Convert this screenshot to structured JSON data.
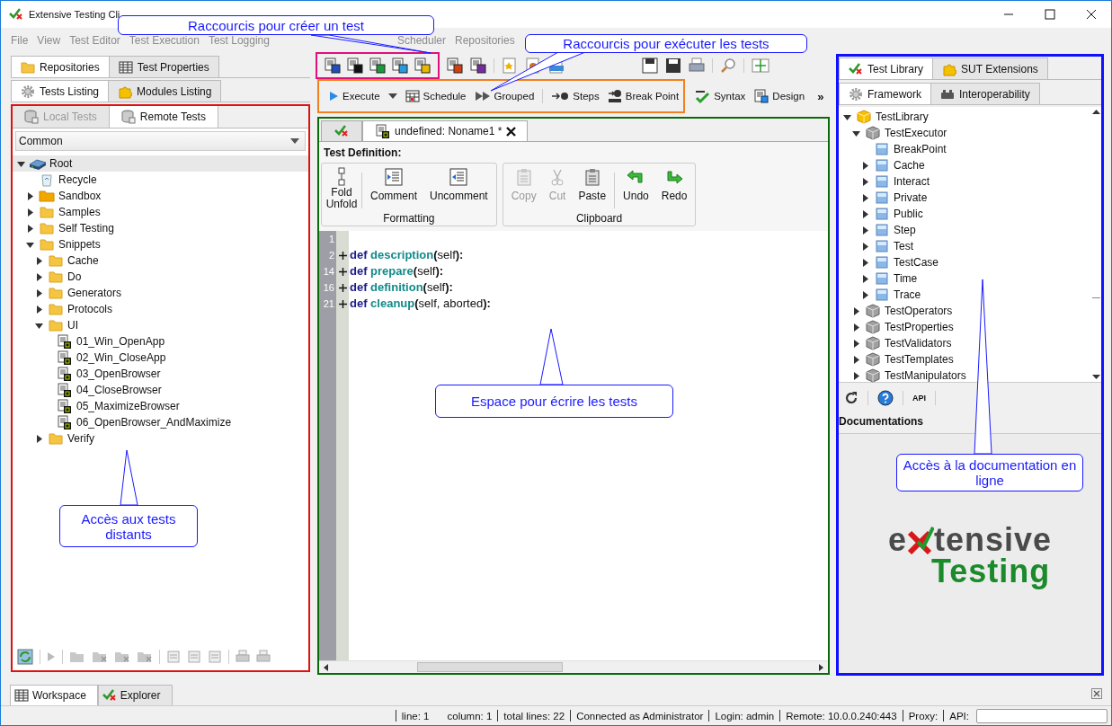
{
  "window": {
    "title": "Extensive Testing Cli"
  },
  "menu": [
    "File",
    "View",
    "Test Editor",
    "Test Execution",
    "Test Logging",
    "Scheduler",
    "Repositories"
  ],
  "toolbar": {
    "actions": [
      {
        "label": "Execute",
        "kind": "execute"
      },
      {
        "label": "Schedule",
        "kind": "schedule"
      },
      {
        "label": "Grouped",
        "kind": "grouped"
      },
      {
        "label": "Steps",
        "kind": "steps"
      },
      {
        "label": "Break Point",
        "kind": "breakpoint"
      },
      {
        "label": "Syntax",
        "kind": "syntax"
      },
      {
        "label": "Design",
        "kind": "design"
      }
    ],
    "overflow": "»"
  },
  "left_panel": {
    "tabs": [
      {
        "label": "Repositories",
        "kind": "folder",
        "selected": true
      },
      {
        "label": "Test Properties",
        "kind": "table",
        "selected": false
      }
    ],
    "subtabs": [
      {
        "label": "Tests Listing",
        "kind": "gear",
        "selected": true
      },
      {
        "label": "Modules Listing",
        "kind": "puzzle",
        "selected": false
      }
    ],
    "source_tabs": [
      {
        "label": "Local Tests",
        "selected": false
      },
      {
        "label": "Remote Tests",
        "selected": true
      }
    ],
    "project": "Common",
    "tree": [
      {
        "label": "Root",
        "kind": "drive",
        "expanded": true,
        "selected": true,
        "children": [
          {
            "label": "Recycle",
            "kind": "trash",
            "selected": false
          },
          {
            "label": "Sandbox",
            "kind": "sandbox",
            "expanded": false,
            "selected": false
          },
          {
            "label": "Samples",
            "kind": "folder",
            "expanded": false,
            "selected": false
          },
          {
            "label": "Self Testing",
            "kind": "folder",
            "expanded": false,
            "selected": false
          },
          {
            "label": "Snippets",
            "kind": "folder",
            "expanded": true,
            "selected": false,
            "children": [
              {
                "label": "Cache",
                "kind": "folder",
                "expanded": false,
                "selected": false
              },
              {
                "label": "Do",
                "kind": "folder",
                "expanded": false,
                "selected": false
              },
              {
                "label": "Generators",
                "kind": "folder",
                "expanded": false,
                "selected": false
              },
              {
                "label": "Protocols",
                "kind": "folder",
                "expanded": false,
                "selected": false
              },
              {
                "label": "UI",
                "kind": "folder",
                "expanded": true,
                "selected": false,
                "children": [
                  {
                    "label": "01_Win_OpenApp",
                    "kind": "test",
                    "selected": false
                  },
                  {
                    "label": "02_Win_CloseApp",
                    "kind": "test",
                    "selected": false
                  },
                  {
                    "label": "03_OpenBrowser",
                    "kind": "test",
                    "selected": false
                  },
                  {
                    "label": "04_CloseBrowser",
                    "kind": "test",
                    "selected": false
                  },
                  {
                    "label": "05_MaximizeBrowser",
                    "kind": "test",
                    "selected": false
                  },
                  {
                    "label": "06_OpenBrowser_AndMaximize",
                    "kind": "test",
                    "selected": false
                  }
                ]
              },
              {
                "label": "Verify",
                "kind": "folder",
                "expanded": false,
                "selected": false
              }
            ]
          }
        ]
      }
    ]
  },
  "editor": {
    "tabs": [
      {
        "kind": "icon",
        "selected": false
      },
      {
        "kind": "file",
        "label": "undefined: Noname1 *",
        "selected": true
      }
    ],
    "section": "Test Definition:",
    "groups": [
      {
        "title": "Formatting",
        "buttons": [
          {
            "label": "Fold Unfold",
            "kind": "fold",
            "disabled": false
          },
          {
            "label": "Comment",
            "kind": "comment",
            "disabled": false
          },
          {
            "label": "Uncomment",
            "kind": "uncomment",
            "disabled": false
          }
        ]
      },
      {
        "title": "Clipboard",
        "buttons": [
          {
            "label": "Copy",
            "kind": "copy",
            "disabled": true
          },
          {
            "label": "Cut",
            "kind": "cut",
            "disabled": true
          },
          {
            "label": "Paste",
            "kind": "paste",
            "disabled": false
          },
          {
            "label": "Undo",
            "kind": "undo",
            "disabled": false
          },
          {
            "label": "Redo",
            "kind": "redo",
            "disabled": false
          }
        ]
      }
    ],
    "lines": [
      {
        "number": "1",
        "folded": false
      },
      {
        "number": "2",
        "folded": true,
        "tokens": [
          {
            "text": "def",
            "kind": "keyword"
          },
          {
            "text": " description",
            "kind": "function"
          },
          {
            "text": "(",
            "kind": "punct"
          },
          {
            "text": "self",
            "kind": "plain"
          },
          {
            "text": "):",
            "kind": "punct"
          }
        ]
      },
      {
        "number": "14",
        "folded": true,
        "tokens": [
          {
            "text": "def",
            "kind": "keyword"
          },
          {
            "text": " prepare",
            "kind": "function"
          },
          {
            "text": "(",
            "kind": "punct"
          },
          {
            "text": "self",
            "kind": "plain"
          },
          {
            "text": "):",
            "kind": "punct"
          }
        ]
      },
      {
        "number": "16",
        "folded": true,
        "tokens": [
          {
            "text": "def",
            "kind": "keyword"
          },
          {
            "text": " definition",
            "kind": "function"
          },
          {
            "text": "(",
            "kind": "punct"
          },
          {
            "text": "self",
            "kind": "plain"
          },
          {
            "text": "):",
            "kind": "punct"
          }
        ]
      },
      {
        "number": "21",
        "folded": true,
        "tokens": [
          {
            "text": "def",
            "kind": "keyword"
          },
          {
            "text": " cleanup",
            "kind": "function"
          },
          {
            "text": "(",
            "kind": "punct"
          },
          {
            "text": "self, aborted",
            "kind": "plain"
          },
          {
            "text": "):",
            "kind": "punct"
          }
        ]
      }
    ]
  },
  "right_panel": {
    "tabs": [
      {
        "label": "Test Library",
        "kind": "checkx",
        "selected": true
      },
      {
        "label": "SUT Extensions",
        "kind": "puzzle",
        "selected": false
      }
    ],
    "subtabs": [
      {
        "label": "Framework",
        "kind": "gear",
        "selected": true
      },
      {
        "label": "Interoperability",
        "kind": "plug",
        "selected": false
      }
    ],
    "tree": [
      {
        "label": "TestLibrary",
        "kind": "package",
        "expanded": true,
        "selected": false,
        "children": [
          {
            "label": "TestExecutor",
            "kind": "module",
            "expanded": true,
            "selected": false,
            "children": [
              {
                "label": "BreakPoint",
                "kind": "class",
                "selected": false
              },
              {
                "label": "Cache",
                "kind": "class",
                "expanded": false,
                "selected": false
              },
              {
                "label": "Interact",
                "kind": "class",
                "expanded": false,
                "selected": false
              },
              {
                "label": "Private",
                "kind": "class",
                "expanded": false,
                "selected": false
              },
              {
                "label": "Public",
                "kind": "class",
                "expanded": false,
                "selected": false
              },
              {
                "label": "Step",
                "kind": "class",
                "expanded": false,
                "selected": false
              },
              {
                "label": "Test",
                "kind": "class",
                "expanded": false,
                "selected": false
              },
              {
                "label": "TestCase",
                "kind": "class",
                "expanded": false,
                "selected": false
              },
              {
                "label": "Time",
                "kind": "class",
                "expanded": false,
                "selected": false
              },
              {
                "label": "Trace",
                "kind": "class",
                "expanded": false,
                "selected": false
              }
            ]
          },
          {
            "label": "TestOperators",
            "kind": "module",
            "expanded": false,
            "selected": false
          },
          {
            "label": "TestProperties",
            "kind": "module",
            "expanded": false,
            "selected": false
          },
          {
            "label": "TestValidators",
            "kind": "module",
            "expanded": false,
            "selected": false
          },
          {
            "label": "TestTemplates",
            "kind": "module",
            "expanded": false,
            "selected": false
          },
          {
            "label": "TestManipulators",
            "kind": "module",
            "expanded": false,
            "selected": false
          }
        ]
      }
    ],
    "api_button": "API",
    "doc_title": "Documentations",
    "logo": {
      "start": "e",
      "end": "tensive",
      "second": "Testing"
    }
  },
  "bottom_tabs": [
    {
      "label": "Workspace",
      "kind": "table",
      "selected": true
    },
    {
      "label": "Explorer",
      "kind": "checkx",
      "selected": false
    }
  ],
  "status_bar": [
    [
      "line: 1",
      "column: 1"
    ],
    [
      "total lines: 22"
    ],
    [
      "Connected as Administrator"
    ],
    [
      "Login: admin"
    ],
    [
      "Remote: 10.0.0.240:443"
    ],
    [
      "Proxy:"
    ],
    [
      "API:"
    ]
  ],
  "callouts": [
    "Raccourcis pour créer un test",
    "Raccourcis pour exécuter les tests",
    "Espace pour écrire les tests",
    "Accès aux tests distants",
    "Accès à la documentation en ligne"
  ]
}
